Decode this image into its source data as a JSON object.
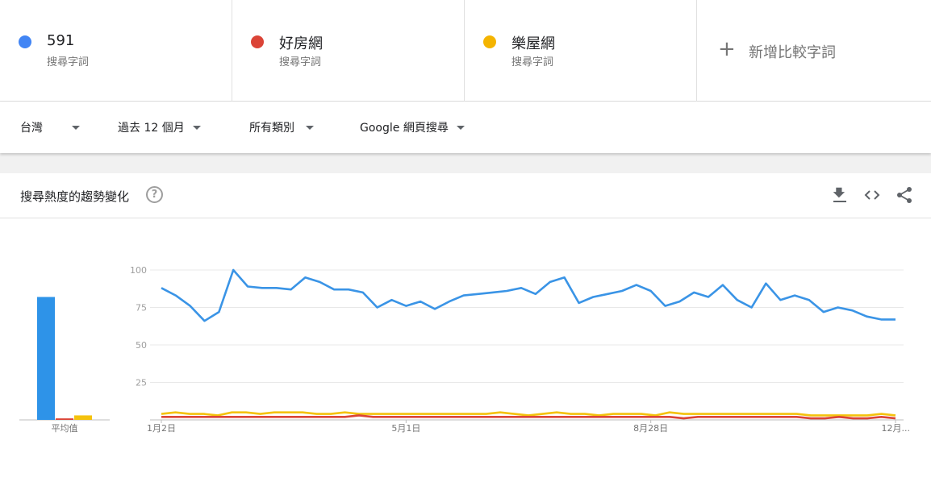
{
  "terms": [
    {
      "name": "591",
      "sub": "搜尋字詞",
      "color": "#4285f4"
    },
    {
      "name": "好房網",
      "sub": "搜尋字詞",
      "color": "#db4437"
    },
    {
      "name": "樂屋網",
      "sub": "搜尋字詞",
      "color": "#f4b400"
    }
  ],
  "add_compare": {
    "label": "新增比較字詞",
    "icon": "plus-icon"
  },
  "filters": {
    "region": "台灣",
    "period": "過去 12 個月",
    "category": "所有類別",
    "search_type": "Google 網頁搜尋"
  },
  "card": {
    "title": "搜尋熱度的趨勢變化",
    "actions": [
      "download-icon",
      "embed-icon",
      "share-icon"
    ]
  },
  "chart_data": [
    {
      "type": "bar",
      "categories": [
        "591",
        "好房網",
        "樂屋網"
      ],
      "values": [
        82,
        1,
        3
      ],
      "xlabel": "平均值",
      "ylim": [
        0,
        100
      ],
      "colors": [
        "#2e93e8",
        "#db4437",
        "#f4c20d"
      ]
    },
    {
      "type": "line",
      "y_ticks": [
        25,
        50,
        75,
        100
      ],
      "ylim": [
        0,
        100
      ],
      "grid": true,
      "x_tick_labels": [
        "1月2日",
        "5月1日",
        "8月28日",
        "12月..."
      ],
      "x_tick_index": [
        0,
        17,
        34,
        52
      ],
      "series": [
        {
          "name": "591",
          "color": "#3a94e6",
          "values": [
            88,
            83,
            76,
            66,
            72,
            100,
            89,
            88,
            88,
            87,
            95,
            92,
            87,
            87,
            85,
            75,
            80,
            76,
            79,
            74,
            79,
            83,
            84,
            85,
            86,
            88,
            84,
            92,
            95,
            78,
            82,
            84,
            86,
            90,
            86,
            76,
            79,
            85,
            82,
            90,
            80,
            75,
            91,
            80,
            83,
            80,
            72,
            75,
            73,
            69,
            67,
            67
          ]
        },
        {
          "name": "好房網",
          "color": "#db4437",
          "values": [
            2,
            2,
            2,
            2,
            2,
            2,
            2,
            2,
            2,
            2,
            2,
            2,
            2,
            2,
            3,
            2,
            2,
            2,
            2,
            2,
            2,
            2,
            2,
            2,
            2,
            2,
            2,
            2,
            2,
            2,
            2,
            2,
            2,
            2,
            2,
            2,
            2,
            1,
            2,
            2,
            2,
            2,
            2,
            2,
            2,
            2,
            1,
            1,
            2,
            1,
            1,
            2,
            1
          ]
        },
        {
          "name": "樂屋網",
          "color": "#f4c20d",
          "values": [
            4,
            5,
            4,
            4,
            3,
            5,
            5,
            4,
            5,
            5,
            5,
            4,
            4,
            5,
            4,
            4,
            4,
            4,
            4,
            4,
            4,
            4,
            4,
            4,
            5,
            4,
            3,
            4,
            5,
            4,
            4,
            3,
            4,
            4,
            4,
            3,
            5,
            4,
            4,
            4,
            4,
            4,
            4,
            4,
            4,
            4,
            3,
            3,
            3,
            3,
            3,
            4,
            3
          ]
        }
      ]
    }
  ]
}
